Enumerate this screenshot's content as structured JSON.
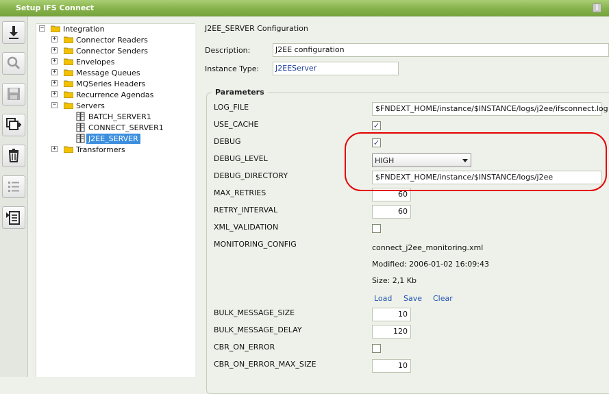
{
  "window": {
    "title": "Setup IFS Connect",
    "info_icon": "info-icon"
  },
  "toolbar": [
    {
      "name": "download-button",
      "icon": "download-icon"
    },
    {
      "name": "search-button",
      "icon": "search-icon"
    },
    {
      "name": "save-button",
      "icon": "save-icon"
    },
    {
      "name": "add-button",
      "icon": "add-icon"
    },
    {
      "name": "delete-button",
      "icon": "trash-icon"
    },
    {
      "name": "list-button",
      "icon": "list-icon"
    },
    {
      "name": "properties-button",
      "icon": "properties-icon"
    }
  ],
  "tree": {
    "root": "Integration",
    "items": [
      "Connector Readers",
      "Connector Senders",
      "Envelopes",
      "Message Queues",
      "MQSeries Headers",
      "Recurrence Agendas",
      "Servers",
      "Transformers"
    ],
    "servers": [
      "BATCH_SERVER1",
      "CONNECT_SERVER1",
      "J2EE_SERVER"
    ],
    "selected": "J2EE_SERVER"
  },
  "main": {
    "title": "J2EE_SERVER Configuration",
    "description_label": "Description:",
    "description_value": "J2EE configuration",
    "instance_type_label": "Instance Type:",
    "instance_type_value": "J2EEServer"
  },
  "parameters": {
    "title": "Parameters",
    "log_file_label": "LOG_FILE",
    "log_file_value": "$FNDEXT_HOME/instance/$INSTANCE/logs/j2ee/ifsconnect.log",
    "use_cache_label": "USE_CACHE",
    "use_cache_checked": true,
    "debug_label": "DEBUG",
    "debug_checked": true,
    "debug_level_label": "DEBUG_LEVEL",
    "debug_level_value": "HIGH",
    "debug_directory_label": "DEBUG_DIRECTORY",
    "debug_directory_value": "$FNDEXT_HOME/instance/$INSTANCE/logs/j2ee",
    "max_retries_label": "MAX_RETRIES",
    "max_retries_value": "60",
    "retry_interval_label": "RETRY_INTERVAL",
    "retry_interval_value": "60",
    "xml_validation_label": "XML_VALIDATION",
    "xml_validation_checked": false,
    "monitoring_config_label": "MONITORING_CONFIG",
    "monitoring_file": "connect_j2ee_monitoring.xml",
    "monitoring_modified": "Modified: 2006-01-02 16:09:43",
    "monitoring_size": "Size: 2,1 Kb",
    "load_link": "Load",
    "save_link": "Save",
    "clear_link": "Clear",
    "bulk_message_size_label": "BULK_MESSAGE_SIZE",
    "bulk_message_size_value": "10",
    "bulk_message_delay_label": "BULK_MESSAGE_DELAY",
    "bulk_message_delay_value": "120",
    "cbr_on_error_label": "CBR_ON_ERROR",
    "cbr_on_error_checked": false,
    "cbr_on_error_max_size_label": "CBR_ON_ERROR_MAX_SIZE",
    "cbr_on_error_max_size_value": "10"
  },
  "colors": {
    "titlebar": "#86b24a",
    "background": "#eef1e9",
    "selection": "#3c8fdf",
    "link": "#1e50b4",
    "highlight_ellipse": "#e30000"
  },
  "checkmark": "✓",
  "expander_plus": "+",
  "expander_minus": "−"
}
